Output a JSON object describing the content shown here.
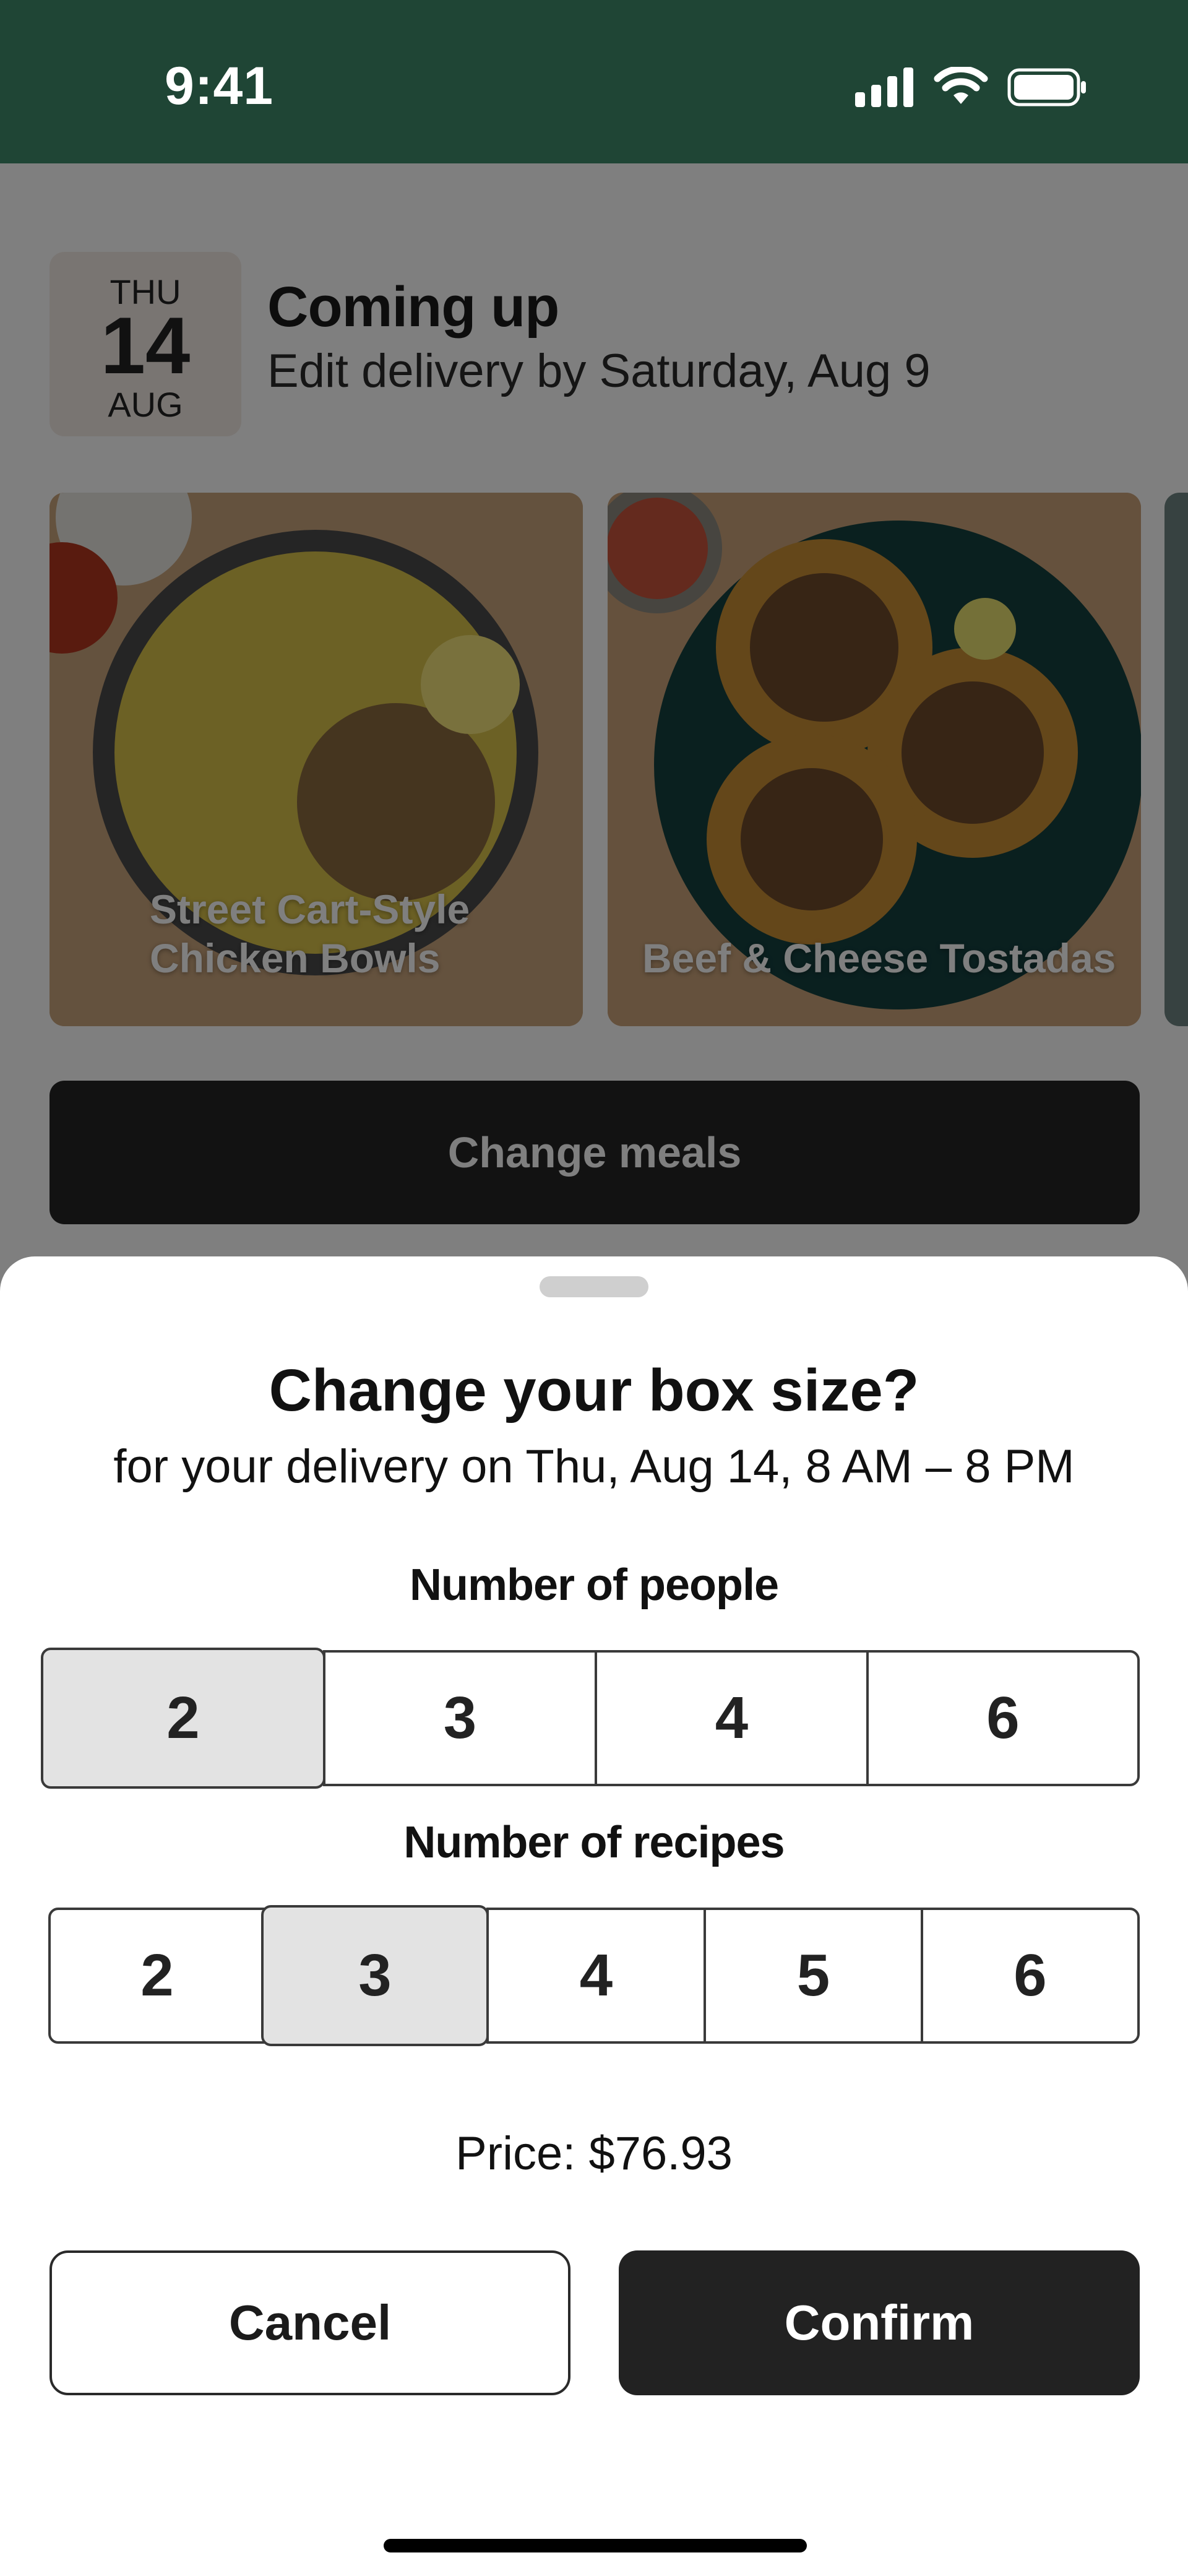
{
  "status_bar": {
    "time": "9:41"
  },
  "upcoming": {
    "day_of_week": "THU",
    "day": "14",
    "month": "AUG",
    "title": "Coming up",
    "subtitle": "Edit delivery by Saturday, Aug 9"
  },
  "meals": [
    {
      "name_line1": "Street Cart-Style",
      "name_line2": "Chicken Bowls"
    },
    {
      "name_line1": "Beef & Cheese Tostadas"
    }
  ],
  "change_meals_label": "Change meals",
  "sheet": {
    "title": "Change your box size?",
    "subtitle": "for your delivery on Thu, Aug 14, 8 AM – 8 PM",
    "people_label": "Number of people",
    "people_options": [
      "2",
      "3",
      "4",
      "6"
    ],
    "people_selected": "2",
    "recipes_label": "Number of recipes",
    "recipe_options": [
      "2",
      "3",
      "4",
      "5",
      "6"
    ],
    "recipes_selected": "3",
    "price": "Price: $76.93",
    "cancel_label": "Cancel",
    "confirm_label": "Confirm"
  },
  "colors": {
    "header_green": "#1f4535",
    "dark_button": "#222222",
    "selected_segment": "#e3e3e3"
  }
}
